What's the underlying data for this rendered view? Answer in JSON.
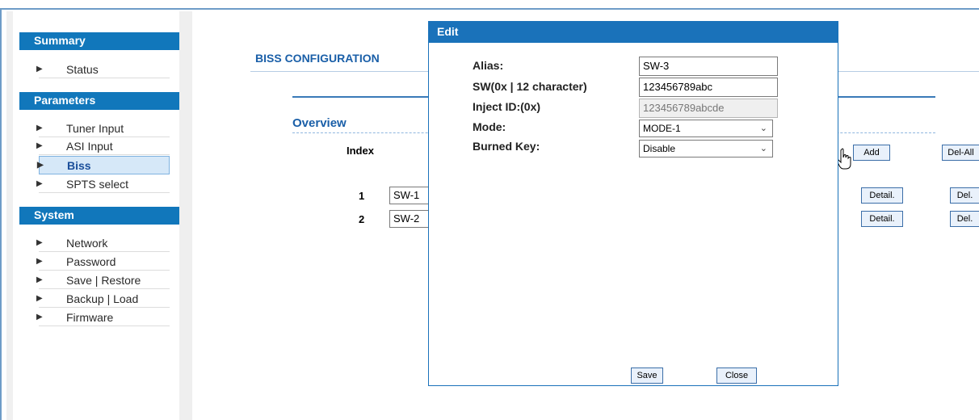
{
  "sidebar": {
    "summary_header": "Summary",
    "summary_items": [
      {
        "label": "Status"
      }
    ],
    "parameters_header": "Parameters",
    "parameters_items": [
      {
        "label": "Tuner Input"
      },
      {
        "label": "ASI Input"
      },
      {
        "label": "Biss"
      },
      {
        "label": "SPTS select"
      }
    ],
    "system_header": "System",
    "system_items": [
      {
        "label": "Network"
      },
      {
        "label": "Password"
      },
      {
        "label": "Save | Restore"
      },
      {
        "label": "Backup | Load"
      },
      {
        "label": "Firmware"
      }
    ]
  },
  "main": {
    "title": "BISS CONFIGURATION",
    "overview": "Overview",
    "index_header": "Index",
    "add_label": "Add",
    "del_all_label": "Del-All",
    "rows": [
      {
        "index": "1",
        "value": "SW-1",
        "detail_label": "Detail.",
        "del_label": "Del."
      },
      {
        "index": "2",
        "value": "SW-2",
        "detail_label": "Detail.",
        "del_label": "Del."
      }
    ]
  },
  "modal": {
    "title": "Edit",
    "alias_label": "Alias:",
    "alias_value": "SW-3",
    "sw_label": "SW(0x | 12 character)",
    "sw_value": "123456789abc",
    "inject_label": "Inject ID:(0x)",
    "inject_value": "123456789abcde",
    "mode_label": "Mode:",
    "mode_value": "MODE-1",
    "burned_label": "Burned Key:",
    "burned_value": "Disable",
    "save_label": "Save",
    "close_label": "Close"
  },
  "colors": {
    "accent": "#1177bb",
    "title_text": "#1a5fa8"
  }
}
